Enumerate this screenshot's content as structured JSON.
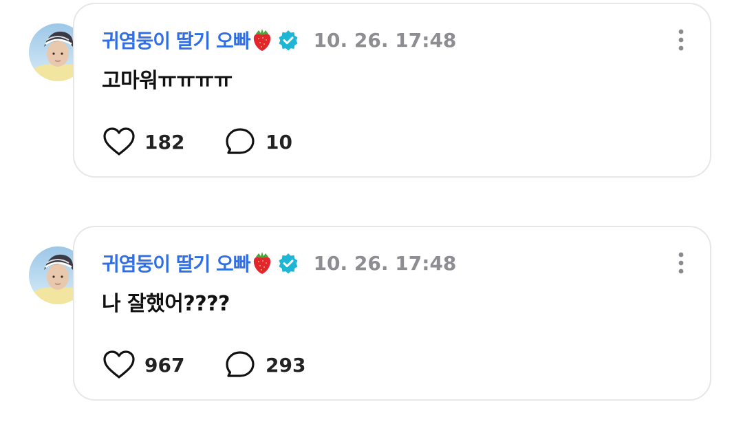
{
  "posts": [
    {
      "author": "귀염둥이 딸기 오빠",
      "timestamp": "10. 26. 17:48",
      "message": "고마워ㅠㅠㅠㅠ",
      "likes": "182",
      "comments": "10"
    },
    {
      "author": "귀염둥이 딸기 오빠",
      "timestamp": "10. 26. 17:48",
      "message": "나 잘했어????",
      "likes": "967",
      "comments": "293"
    }
  ],
  "icons": {
    "like": "heart-icon",
    "comment": "speech-bubble-icon",
    "more": "vertical-ellipsis-icon",
    "verified": "verified-badge-icon",
    "emoji": "strawberry"
  },
  "colors": {
    "author": "#2f6fe3",
    "timestamp": "#8d8d92",
    "verified": "#1fb6d6",
    "card_border": "#e7e7ea"
  }
}
